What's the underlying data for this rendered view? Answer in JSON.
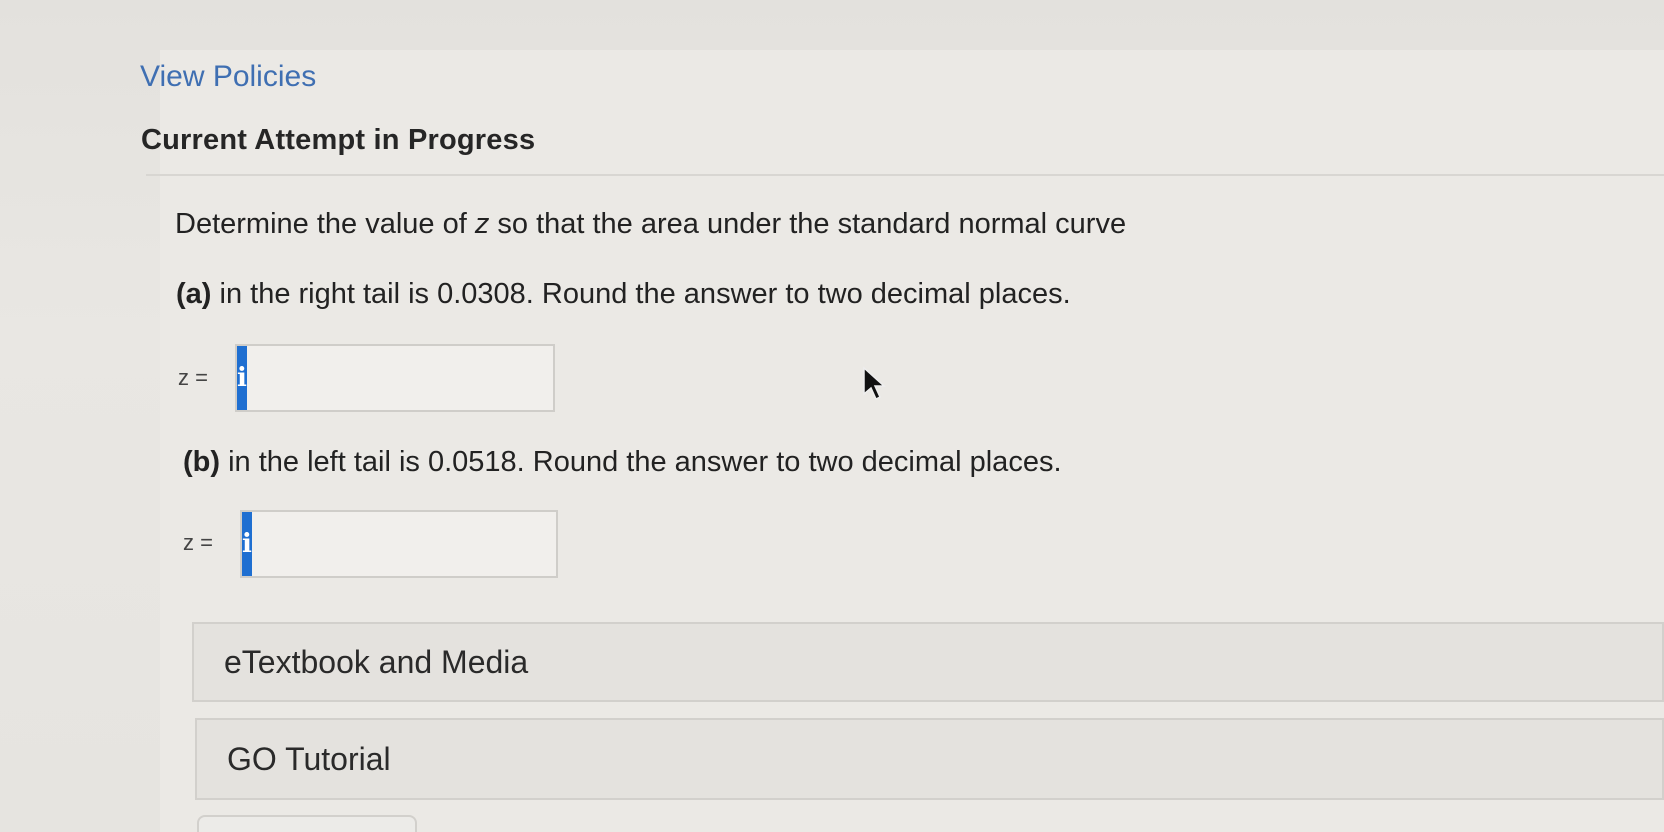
{
  "links": {
    "view_policies": "View Policies"
  },
  "header": {
    "attempt_status": "Current Attempt in Progress"
  },
  "question": {
    "prompt_before": "Determine the value of ",
    "prompt_var": "z",
    "prompt_after": " so that the area under the standard normal curve",
    "parts": [
      {
        "label": "(a)",
        "text": " in the right tail is 0.0308. Round the answer to two decimal places.",
        "answer_label": "z =",
        "answer_value": "",
        "info_icon": "info-icon"
      },
      {
        "label": "(b)",
        "text": " in the left tail is 0.0518. Round the answer to two decimal places.",
        "answer_label": "z =",
        "answer_value": "",
        "info_icon": "info-icon"
      }
    ]
  },
  "resources": [
    "eTextbook and Media",
    "GO Tutorial"
  ],
  "colors": {
    "link": "#3f6fb2",
    "info_button": "#1f6fd1"
  }
}
